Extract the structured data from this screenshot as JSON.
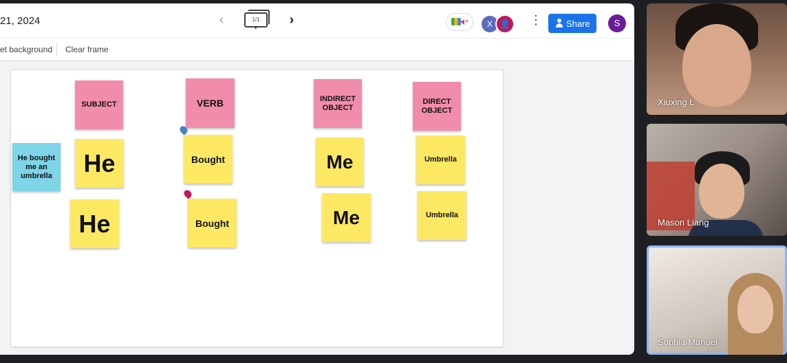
{
  "header": {
    "doc_title": "21, 2024",
    "frame_counter": "1/1",
    "share_label": "Share",
    "avatar_initial": "S",
    "collaborator_x": "X"
  },
  "toolbar": {
    "background_label": "et background",
    "clear_label": "Clear frame"
  },
  "notes": {
    "subject": "SUBJECT",
    "verb": "VERB",
    "indirect": "INDIRECT\nOBJECT",
    "direct": "DIRECT\nOBJECT",
    "sentence": "He bought me an umbrella",
    "he1": "He",
    "bought1": "Bought",
    "me1": "Me",
    "umbrella1": "Umbrella",
    "he2": "He",
    "bought2": "Bought",
    "me2": "Me",
    "umbrella2": "Umbrella"
  },
  "participants": [
    {
      "name": "Xiuxing L"
    },
    {
      "name": "Mason Liang"
    },
    {
      "name": "Sophia Manuel"
    }
  ],
  "colors": {
    "pink_note": "#f28cab",
    "yellow_note": "#fde863",
    "blue_note": "#7fd4e8",
    "share_blue": "#1a73e8"
  }
}
